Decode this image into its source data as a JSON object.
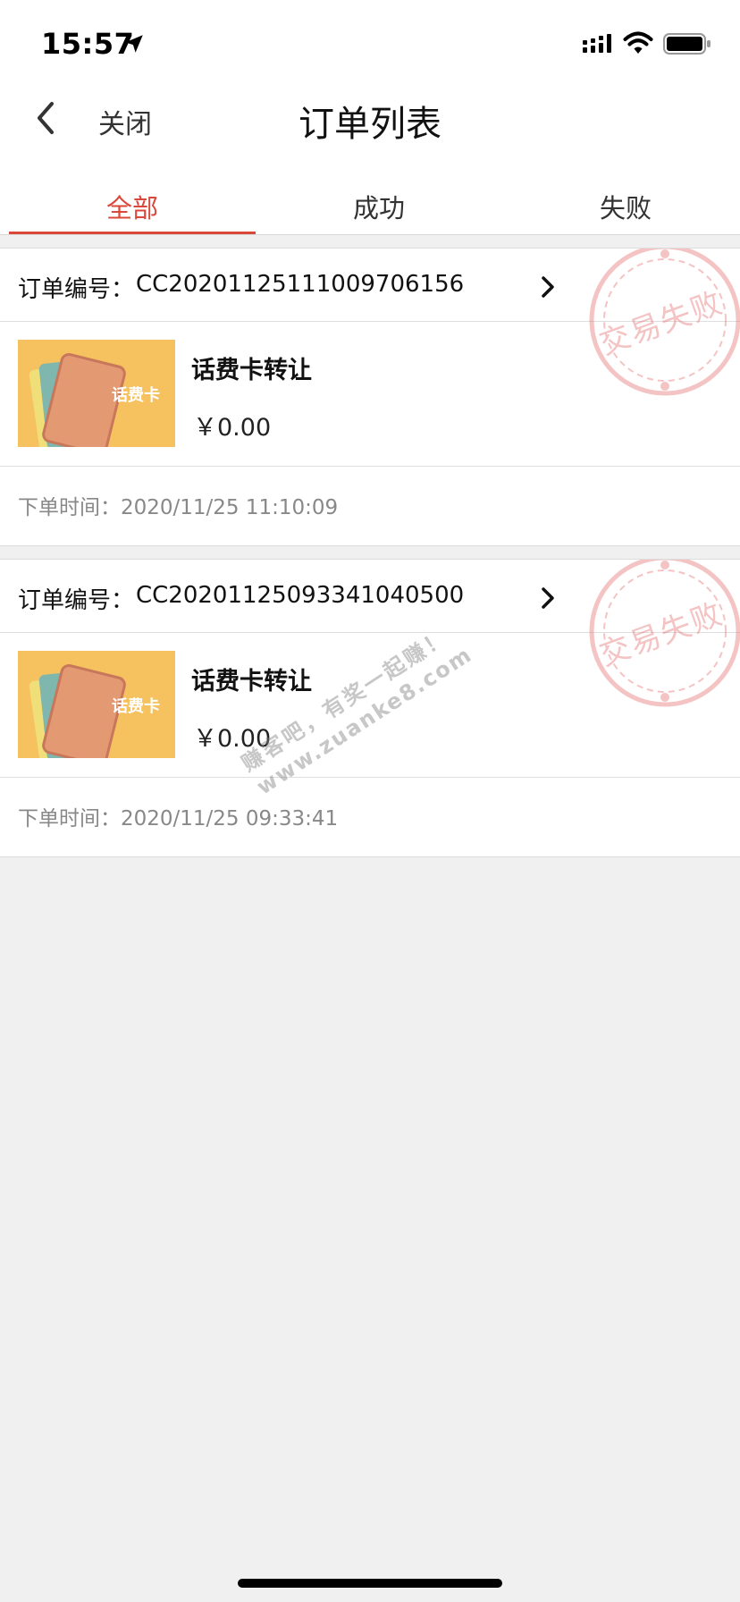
{
  "status_bar": {
    "time": "15:57"
  },
  "nav": {
    "close_label": "关闭",
    "title": "订单列表"
  },
  "tabs": [
    {
      "label": "全部",
      "active": true
    },
    {
      "label": "成功",
      "active": false
    },
    {
      "label": "失败",
      "active": false
    }
  ],
  "orders": [
    {
      "order_label": "订单编号：",
      "order_number": "CC20201125111009706156",
      "stamp": "交易失败",
      "thumb_label": "话费卡",
      "product_name": "话费卡转让",
      "price": "￥0.00",
      "time": "下单时间：2020/11/25 11:10:09"
    },
    {
      "order_label": "订单编号：",
      "order_number": "CC20201125093341040500",
      "stamp": "交易失败",
      "thumb_label": "话费卡",
      "product_name": "话费卡转让",
      "price": "￥0.00",
      "time": "下单时间：2020/11/25 09:33:41"
    }
  ],
  "watermark": {
    "line1": "赚客吧，有奖一起赚！",
    "line2": "www.zuanke8.com"
  },
  "colors": {
    "accent": "#d9483b",
    "stamp": "#e57373",
    "thumb_bg": "#f5c25f"
  }
}
